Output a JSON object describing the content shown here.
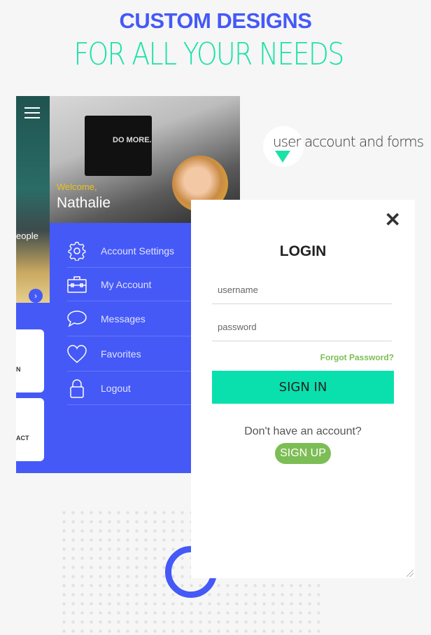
{
  "headline": {
    "line1": "CUSTOM DESIGNS",
    "line2": "FOR ALL YOUR NEEDS"
  },
  "feature_tag": "user account and forms",
  "left_phone": {
    "caption": "eople",
    "cards": [
      "N",
      "ACT"
    ]
  },
  "menu": {
    "welcome": "Welcome,",
    "user_name": "Nathalie",
    "hero_screen_text": "DO MORE.",
    "items": [
      {
        "label": "Account Settings",
        "icon": "gear-icon"
      },
      {
        "label": "My Account",
        "icon": "briefcase-icon"
      },
      {
        "label": "Messages",
        "icon": "speech-bubble-icon"
      },
      {
        "label": "Favorites",
        "icon": "heart-icon"
      },
      {
        "label": "Logout",
        "icon": "lock-icon"
      }
    ]
  },
  "login": {
    "title": "LOGIN",
    "close": "✕",
    "username_placeholder": "username",
    "password_placeholder": "password",
    "forgot": "Forgot Password?",
    "signin": "SIGN IN",
    "no_account": "Don't have an account?",
    "signup": "SIGN UP"
  },
  "colors": {
    "blue": "#4559f7",
    "teal": "#19e2a6",
    "signin": "#0ae0ae",
    "green": "#7dbd55"
  }
}
